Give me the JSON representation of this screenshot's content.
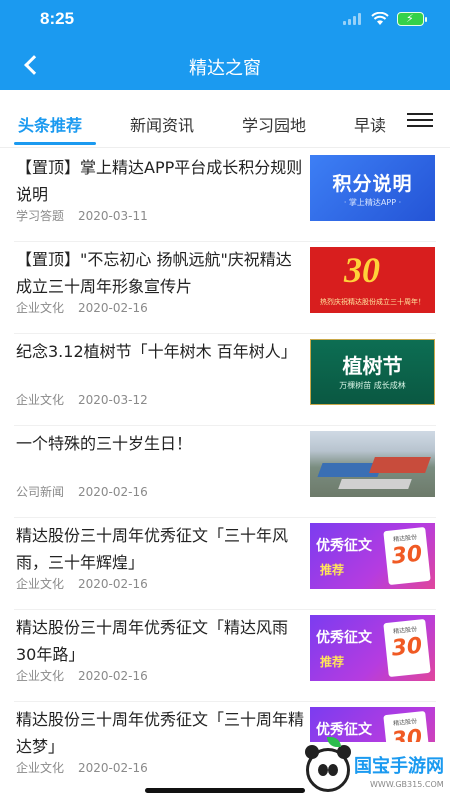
{
  "status_bar": {
    "time": "8:25"
  },
  "nav": {
    "title": "精达之窗"
  },
  "tabs": [
    "头条推荐",
    "新闻资讯",
    "学习园地",
    "早读"
  ],
  "news": [
    {
      "title": "【置顶】掌上精达APP平台成长积分规则说明",
      "category": "学习答题",
      "date": "2020-03-11",
      "thumb": {
        "type": "points",
        "main": "积分说明",
        "sub": "· 掌上精达APP ·"
      }
    },
    {
      "title": "【置顶】\"不忘初心  扬帆远航\"庆祝精达成立三十周年形象宣传片",
      "category": "企业文化",
      "date": "2020-02-16",
      "thumb": {
        "type": "anniversary",
        "main": "30",
        "sub": "热烈庆祝精达股份成立三十周年！"
      }
    },
    {
      "title": "纪念3.12植树节「十年树木  百年树人」",
      "category": "企业文化",
      "date": "2020-03-12",
      "thumb": {
        "type": "tree",
        "main": "植树节",
        "sub": "万棵树苗  成长成林"
      }
    },
    {
      "title": "一个特殊的三十岁生日！",
      "category": "公司新闻",
      "date": "2020-02-16",
      "thumb": {
        "type": "photo"
      }
    },
    {
      "title": "精达股份三十周年优秀征文「三十年风雨，三十年辉煌」",
      "category": "企业文化",
      "date": "2020-02-16",
      "thumb": {
        "type": "essay",
        "main": "优秀征文",
        "sub": "推荐",
        "card_top": "精达股份",
        "card_num": "30"
      }
    },
    {
      "title": "精达股份三十周年优秀征文「精达风雨30年路」",
      "category": "企业文化",
      "date": "2020-02-16",
      "thumb": {
        "type": "essay",
        "main": "优秀征文",
        "sub": "推荐",
        "card_top": "精达股份",
        "card_num": "30"
      }
    },
    {
      "title": "精达股份三十周年优秀征文「三十周年精达梦」",
      "category": "企业文化",
      "date": "2020-02-16",
      "thumb": {
        "type": "essay",
        "main": "优秀征文",
        "sub": "",
        "card_top": "精达股份",
        "card_num": "30"
      }
    }
  ],
  "watermark": {
    "text": "国宝手游网",
    "url": "WWW.GB315.COM"
  },
  "icons": {
    "back": "chevron-left-icon",
    "menu": "hamburger-menu-icon",
    "wifi": "wifi-icon",
    "battery": "battery-icon",
    "signal": "signal-icon"
  },
  "colors": {
    "primary": "#1b9af0"
  }
}
